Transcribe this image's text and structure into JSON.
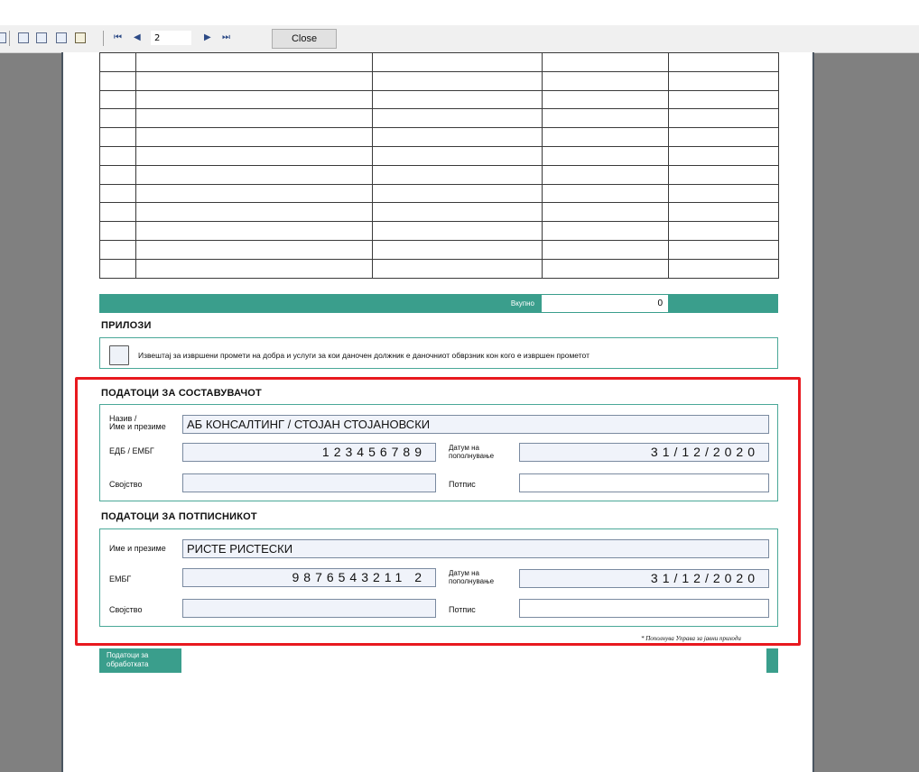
{
  "toolbar": {
    "icons": [
      "print-icon",
      "page-layout-icon",
      "page-setup-icon",
      "book-icon",
      "edit-icon"
    ],
    "nav": {
      "first": "⏮",
      "prev": "◀",
      "next": "▶",
      "last": "⏭"
    },
    "page_number": "2",
    "close_label": "Close"
  },
  "form": {
    "total": {
      "label": "Вкупно",
      "value": "0"
    },
    "attachments": {
      "title": "ПРИЛОЗИ",
      "checkbox_text": "Извештај за извршени промети на добра и услуги за кои даночен должник е даночниот обврзник кон кого е извршен прометот"
    },
    "compiler": {
      "title": "ПОДАТОЦИ ЗА СОСТАВУВАЧОТ",
      "name_label": "Назив /\nИме и презиме",
      "name_value": "АБ КОНСАЛТИНГ / СТОЈАН СТОЈАНОВСКИ",
      "edb_label": "ЕДБ / ЕМБГ",
      "edb_value": "123456789",
      "date_label": "Датум на\nпополнување",
      "date_value": "31/12/2020",
      "role_label": "Својство",
      "role_value": "",
      "signature_label": "Потпис",
      "signature_value": ""
    },
    "signatory": {
      "title": "ПОДАТОЦИ ЗА ПОТПИСНИКОТ",
      "name_label": "Име и презиме",
      "name_value": "РИСТЕ  РИСТЕСКИ",
      "embg_label": "ЕМБГ",
      "embg_value": "9876543211 2",
      "date_label": "Датум на\nпополнување",
      "date_value": "31/12/2020",
      "role_label": "Својство",
      "role_value": "",
      "signature_label": "Потпис",
      "signature_value": ""
    },
    "footnote": "* Пополнува Управа за јавни приходи",
    "processing": {
      "label": "Податоци за\nобработката",
      "value": ""
    }
  },
  "colors": {
    "accent": "#3a9e8c",
    "highlight": "#e8191f"
  }
}
